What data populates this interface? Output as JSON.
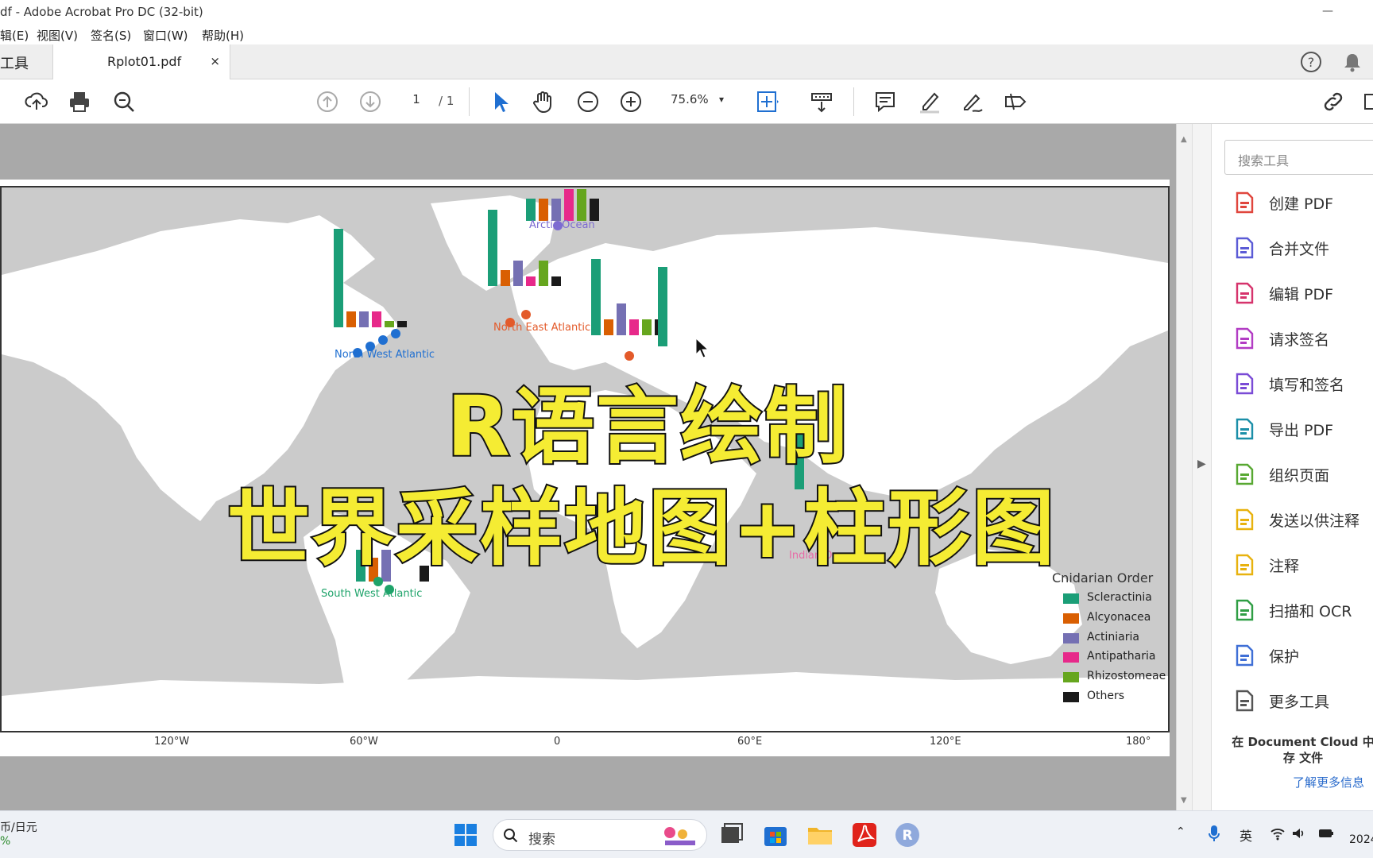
{
  "window": {
    "title": "df - Adobe Acrobat Pro DC (32-bit)",
    "minimize": "—"
  },
  "menu": [
    "辑(E)",
    "视图(V)",
    "签名(S)",
    "窗口(W)",
    "帮助(H)"
  ],
  "tabs": {
    "tools_label": "工具",
    "doc_name": "Rplot01.pdf",
    "close": "×"
  },
  "toolbar": {
    "page_current": "1",
    "page_total": "/ 1",
    "zoom": "75.6%"
  },
  "map": {
    "axis_ticks": [
      "120°W",
      "60°W",
      "0",
      "60°E",
      "120°E",
      "180°"
    ],
    "regions": [
      {
        "name": "Arctic Ocean",
        "color": "#7c6bd1"
      },
      {
        "name": "North West Atlantic",
        "color": "#1f6fd1"
      },
      {
        "name": "North East Atlantic",
        "color": "#e35a2a"
      },
      {
        "name": "South West Atlantic",
        "color": "#1ea36a"
      },
      {
        "name": "Indian Ocean",
        "color": "#e86aa6"
      }
    ],
    "legend": {
      "title": "Cnidarian Order",
      "items": [
        {
          "label": "Scleractinia",
          "color": "#1b9e77"
        },
        {
          "label": "Alcyonacea",
          "color": "#d95f02"
        },
        {
          "label": "Actiniaria",
          "color": "#7570b3"
        },
        {
          "label": "Antipatharia",
          "color": "#e7298a"
        },
        {
          "label": "Rhizostomeae",
          "color": "#66a61e"
        },
        {
          "label": "Others",
          "color": "#1a1a1a"
        }
      ]
    }
  },
  "overlay": {
    "line1": "R语言绘制",
    "line2": "世界采样地图+柱形图"
  },
  "right_pane": {
    "search_placeholder": "搜索工具",
    "tools": [
      {
        "label": "创建 PDF",
        "icon": "create-pdf-icon",
        "color": "#e0463d"
      },
      {
        "label": "合并文件",
        "icon": "combine-files-icon",
        "color": "#5b5bd6"
      },
      {
        "label": "编辑 PDF",
        "icon": "edit-pdf-icon",
        "color": "#d6336c"
      },
      {
        "label": "请求签名",
        "icon": "request-signature-icon",
        "color": "#b23cc4"
      },
      {
        "label": "填写和签名",
        "icon": "fill-sign-icon",
        "color": "#7a4bd6"
      },
      {
        "label": "导出 PDF",
        "icon": "export-pdf-icon",
        "color": "#1b8fa8"
      },
      {
        "label": "组织页面",
        "icon": "organize-pages-icon",
        "color": "#58a832"
      },
      {
        "label": "发送以供注释",
        "icon": "send-comments-icon",
        "color": "#e8b20e"
      },
      {
        "label": "注释",
        "icon": "comment-icon",
        "color": "#e8b20e"
      },
      {
        "label": "扫描和 OCR",
        "icon": "scan-ocr-icon",
        "color": "#2f9e44"
      },
      {
        "label": "保护",
        "icon": "protect-icon",
        "color": "#3f6fd6"
      },
      {
        "label": "更多工具",
        "icon": "more-tools-icon",
        "color": "#555555"
      }
    ],
    "cloud_text": "在 Document Cloud 中存 文件",
    "cloud_link": "了解更多信息"
  },
  "taskbar": {
    "stock_line1": "币/日元",
    "stock_line2": "%",
    "search_label": "搜索",
    "ime": "英",
    "clock": "2024"
  }
}
